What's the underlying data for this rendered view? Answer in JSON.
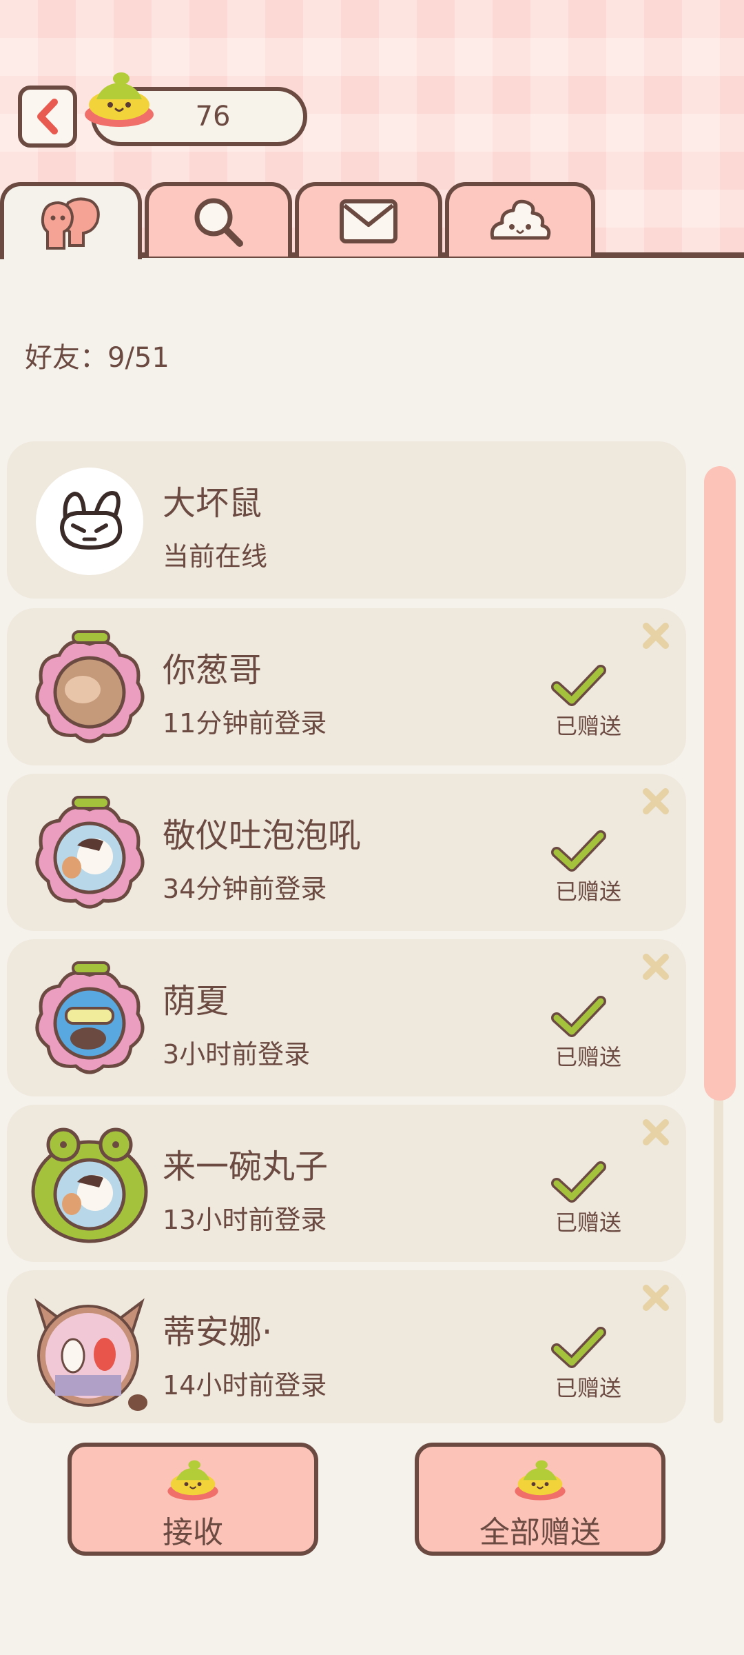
{
  "header": {
    "coin_count": "76"
  },
  "tabs": [
    {
      "icon": "friends-icon",
      "active": true
    },
    {
      "icon": "search-icon",
      "active": false
    },
    {
      "icon": "mail-icon",
      "active": false
    },
    {
      "icon": "poop-icon",
      "active": false
    }
  ],
  "friends": {
    "count_label": "好友：9/51",
    "list": [
      {
        "name": "大坏鼠",
        "status": "当前在线",
        "gifted": false
      },
      {
        "name": "你葱哥",
        "status": "11分钟前登录",
        "gifted": true,
        "gift_label": "已赠送"
      },
      {
        "name": "敬仪吐泡泡吼",
        "status": "34分钟前登录",
        "gifted": true,
        "gift_label": "已赠送"
      },
      {
        "name": "荫夏",
        "status": "3小时前登录",
        "gifted": true,
        "gift_label": "已赠送"
      },
      {
        "name": "来一碗丸子",
        "status": "13小时前登录",
        "gifted": true,
        "gift_label": "已赠送"
      },
      {
        "name": "蒂安娜·",
        "status": "14小时前登录",
        "gifted": true,
        "gift_label": "已赠送"
      }
    ]
  },
  "actions": {
    "receive_label": "接收",
    "send_all_label": "全部赠送"
  },
  "colors": {
    "outline": "#6b4a42",
    "tab_pink": "#fcc8bf",
    "card_bg": "#efe8dd",
    "check_green": "#a4c23c",
    "close_x": "#e6d2a4",
    "scroll_thumb": "#fcc3b8"
  }
}
